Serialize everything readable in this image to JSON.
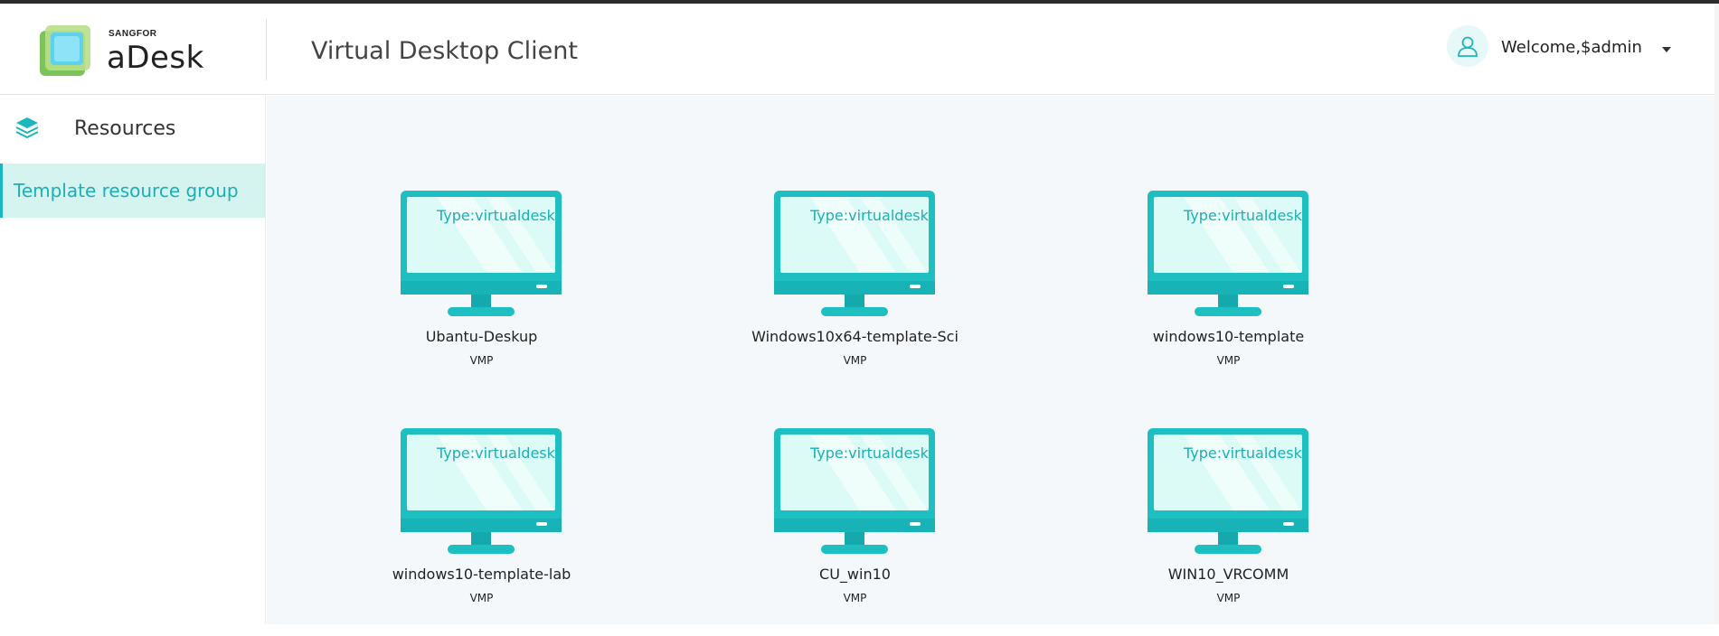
{
  "header": {
    "brand_small": "SANGFOR",
    "brand_name": "aDesk",
    "title": "Virtual Desktop Client",
    "user_welcome": "Welcome,$admin",
    "avatar_icon": "user-icon",
    "dropdown_icon": "caret-down-icon"
  },
  "sidebar": {
    "section_icon": "layers-icon",
    "section_label": "Resources",
    "items": [
      {
        "label": "Template resource group",
        "active": true
      }
    ]
  },
  "resources": [
    {
      "type_label": "Type:virtualdesk",
      "name": "Ubantu-Deskup",
      "host": "VMP"
    },
    {
      "type_label": "Type:virtualdesk",
      "name": "Windows10x64-template-Sci",
      "host": "VMP"
    },
    {
      "type_label": "Type:virtualdesk",
      "name": "windows10-template",
      "host": "VMP"
    },
    {
      "type_label": "Type:virtualdesk",
      "name": "windows10-template-lab",
      "host": "VMP"
    },
    {
      "type_label": "Type:virtualdesk",
      "name": "CU_win10",
      "host": "VMP"
    },
    {
      "type_label": "Type:virtualdesk",
      "name": "WIN10_VRCOMM",
      "host": "VMP"
    }
  ],
  "colors": {
    "accent": "#1ab8bd",
    "monitor_body": "#1dbfc1",
    "monitor_screen": "#dcfbf6",
    "active_bg": "#d5f3ef",
    "content_bg": "#f4f8fa"
  }
}
